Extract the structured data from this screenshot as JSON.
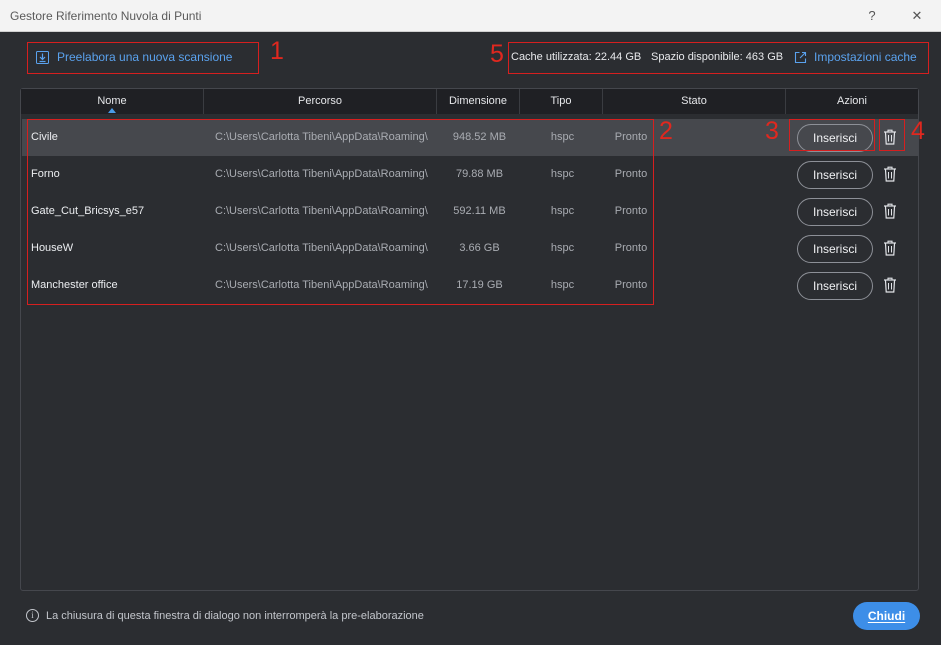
{
  "window": {
    "title": "Gestore Riferimento Nuvola di Punti",
    "help_label": "?",
    "close_label": "✕"
  },
  "toolbar": {
    "preprocess_label": "Preelabora una nuova scansione",
    "cache_used": "Cache utilizzata: 22.44 GB",
    "space_available": "Spazio disponibile: 463 GB",
    "cache_settings_label": "Impostazioni cache"
  },
  "table": {
    "columns": [
      "Nome",
      "Percorso",
      "Dimensione",
      "Tipo",
      "Stato",
      "Azioni"
    ],
    "sorted_column": "Nome",
    "rows": [
      {
        "name": "Civile",
        "path": "C:\\Users\\Carlotta Tibeni\\AppData\\Roaming\\",
        "size": "948.52 MB",
        "type": "hspc",
        "state": "Pronto",
        "action": "Inserisci",
        "selected": true
      },
      {
        "name": "Forno",
        "path": "C:\\Users\\Carlotta Tibeni\\AppData\\Roaming\\",
        "size": "79.88 MB",
        "type": "hspc",
        "state": "Pronto",
        "action": "Inserisci",
        "selected": false
      },
      {
        "name": "Gate_Cut_Bricsys_e57",
        "path": "C:\\Users\\Carlotta Tibeni\\AppData\\Roaming\\",
        "size": "592.11 MB",
        "type": "hspc",
        "state": "Pronto",
        "action": "Inserisci",
        "selected": false
      },
      {
        "name": "HouseW",
        "path": "C:\\Users\\Carlotta Tibeni\\AppData\\Roaming\\",
        "size": "3.66 GB",
        "type": "hspc",
        "state": "Pronto",
        "action": "Inserisci",
        "selected": false
      },
      {
        "name": "Manchester office",
        "path": "C:\\Users\\Carlotta Tibeni\\AppData\\Roaming\\",
        "size": "17.19 GB",
        "type": "hspc",
        "state": "Pronto",
        "action": "Inserisci",
        "selected": false
      }
    ]
  },
  "annotations": [
    "1",
    "2",
    "3",
    "4",
    "5"
  ],
  "footer": {
    "info_icon_label": "i",
    "note": "La chiusura di questa finestra di dialogo non interromperà la pre-elaborazione",
    "close_button": "Chiudi"
  },
  "colors": {
    "accent": "#3d8ee8",
    "link": "#5aa2ee",
    "annotation": "#d61f1f",
    "background": "#2b2d31",
    "header": "#1f2024",
    "selected_row": "#46484d"
  },
  "icons": {
    "preprocess": "download-icon",
    "cache_settings": "external-link-icon",
    "delete": "trash-icon",
    "info": "info-icon"
  }
}
